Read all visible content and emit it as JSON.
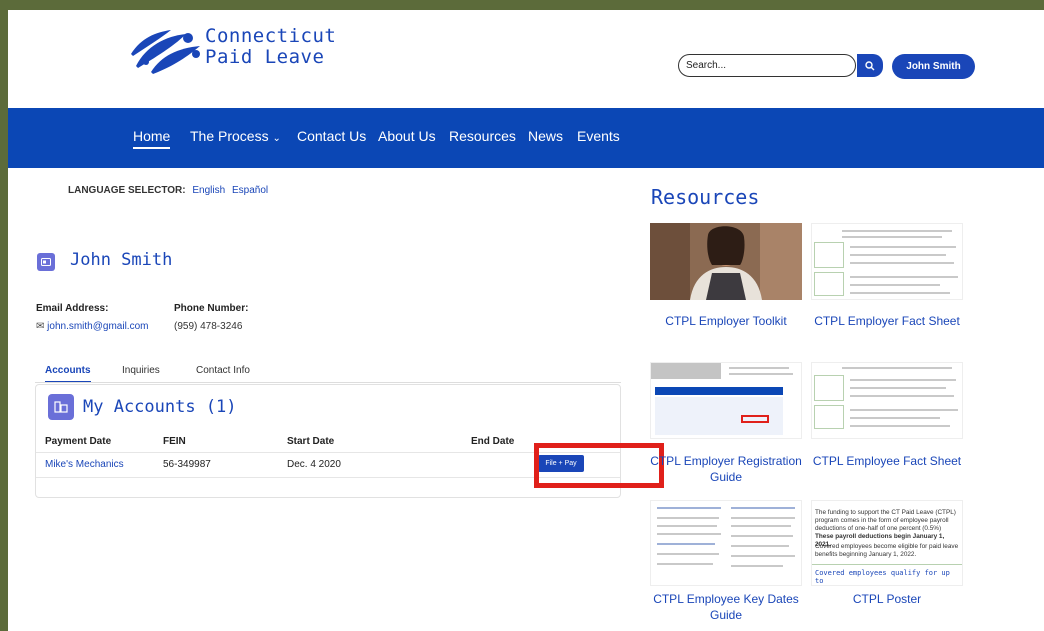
{
  "brand": {
    "line1": "Connecticut",
    "line2": "Paid Leave",
    "logo_icon": "ct-leaf-logo"
  },
  "header": {
    "search_placeholder": "Search...",
    "user_button": "John Smith",
    "search_icon": "search-icon"
  },
  "nav": [
    "Home",
    "The Process",
    "Contact Us",
    "About Us",
    "Resources",
    "News",
    "Events"
  ],
  "language": {
    "label": "LANGUAGE SELECTOR:",
    "english": "English",
    "spanish": "Español"
  },
  "profile": {
    "name": "John Smith",
    "email_label": "Email Address:",
    "email": "john.smith@gmail.com",
    "phone_label": "Phone Number:",
    "phone": "(959) 478-3246"
  },
  "tabs": [
    "Accounts",
    "Inquiries",
    "Contact Info"
  ],
  "accounts": {
    "title": "My Accounts (1)",
    "columns": [
      "Payment Date",
      "FEIN",
      "Start Date",
      "End Date"
    ],
    "rows": [
      {
        "name": "Mike's Mechanics",
        "fein": "56-349987",
        "start": "Dec. 4 2020",
        "end": "",
        "action": "File + Pay"
      }
    ]
  },
  "resources": {
    "title": "Resources",
    "items": [
      "CTPL Employer Toolkit",
      "CTPL Employer Fact Sheet",
      "CTPL Employer Registration Guide",
      "CTPL Employee Fact Sheet",
      "CTPL Employee Key Dates Guide",
      "CTPL Poster"
    ],
    "poster_text": "The funding to support the CT Paid Leave (CTPL) program comes in the form of employee payroll deductions of one-half of one percent (0.5%)",
    "poster_bold": "These payroll deductions begin January 1, 2021.",
    "poster_text2": "Covered employees become eligible for paid leave benefits beginning January 1, 2022.",
    "poster_banner": "Covered employees qualify for up to"
  },
  "colors": {
    "primary": "#1a46b8",
    "nav": "#0b47b5",
    "accent": "#6a6fd8",
    "highlight": "#e0201a"
  }
}
